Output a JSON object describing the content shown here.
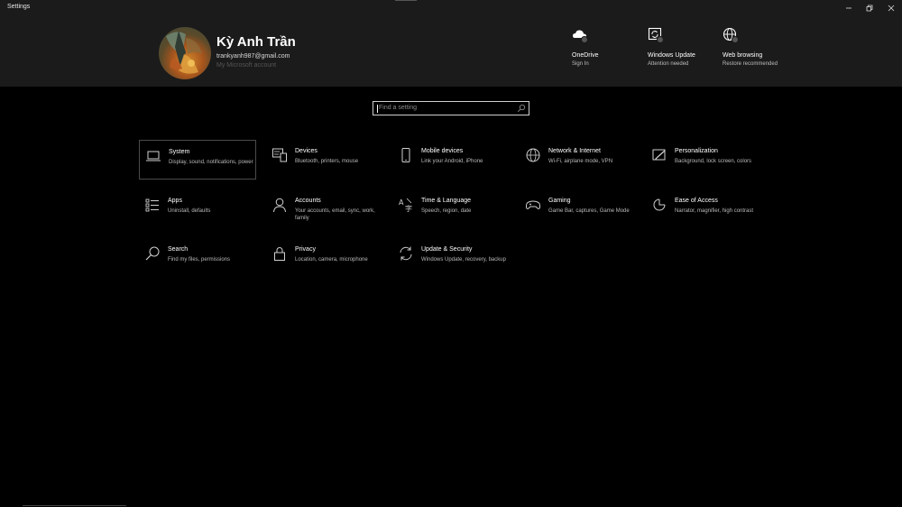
{
  "window": {
    "title": "Settings"
  },
  "user": {
    "name": "Kỳ Anh Trần",
    "email": "trankyanh987@gmail.com",
    "account_link": "My Microsoft account"
  },
  "quick_links": [
    {
      "title": "OneDrive",
      "subtitle": "Sign In",
      "icon": "cloud-icon"
    },
    {
      "title": "Windows Update",
      "subtitle": "Attention needed",
      "icon": "update-icon"
    },
    {
      "title": "Web browsing",
      "subtitle": "Restore recommended",
      "icon": "globe-icon"
    }
  ],
  "search": {
    "placeholder": "Find a setting"
  },
  "categories": [
    {
      "name": "System",
      "desc": "Display, sound, notifications, power",
      "icon": "laptop-icon",
      "selected": true
    },
    {
      "name": "Devices",
      "desc": "Bluetooth, printers, mouse",
      "icon": "keyboard-icon"
    },
    {
      "name": "Mobile devices",
      "desc": "Link your Android, iPhone",
      "icon": "phone-icon"
    },
    {
      "name": "Network & Internet",
      "desc": "Wi-Fi, airplane mode, VPN",
      "icon": "globe-icon"
    },
    {
      "name": "Personalization",
      "desc": "Background, lock screen, colors",
      "icon": "paint-icon"
    },
    {
      "name": "Apps",
      "desc": "Uninstall, defaults",
      "icon": "apps-list-icon"
    },
    {
      "name": "Accounts",
      "desc": "Your accounts, email, sync, work, family",
      "icon": "person-icon"
    },
    {
      "name": "Time & Language",
      "desc": "Speech, region, date",
      "icon": "time-language-icon"
    },
    {
      "name": "Gaming",
      "desc": "Game Bar, captures, Game Mode",
      "icon": "gamepad-icon"
    },
    {
      "name": "Ease of Access",
      "desc": "Narrator, magnifier, high contrast",
      "icon": "ease-of-access-icon"
    },
    {
      "name": "Search",
      "desc": "Find my files, permissions",
      "icon": "search-icon"
    },
    {
      "name": "Privacy",
      "desc": "Location, camera, microphone",
      "icon": "lock-icon"
    },
    {
      "name": "Update & Security",
      "desc": "Windows Update, recovery, backup",
      "icon": "sync-icon"
    }
  ]
}
